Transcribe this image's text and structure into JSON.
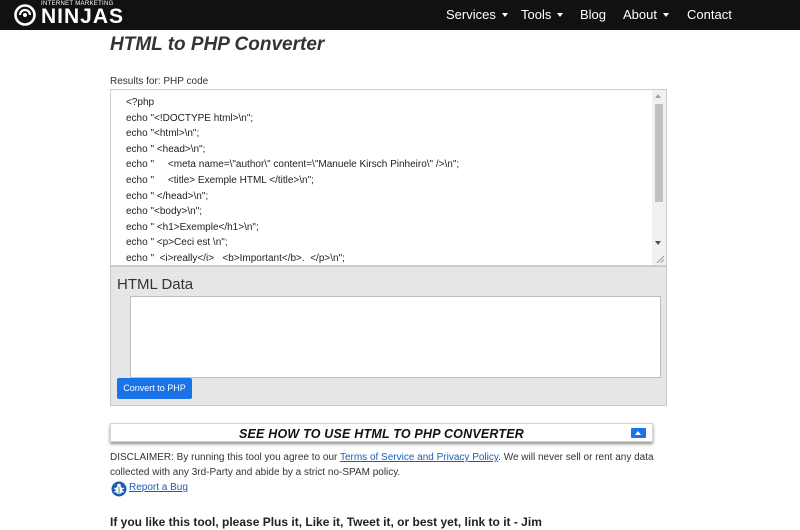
{
  "brand": {
    "small_text": "INTERNET MARKETING",
    "big_text": "NINJAS"
  },
  "nav": {
    "services": "Services",
    "tools": "Tools",
    "blog": "Blog",
    "about": "About",
    "contact": "Contact"
  },
  "page": {
    "title": "HTML to PHP Converter"
  },
  "results": {
    "label": "Results for: PHP code",
    "lines": [
      "<?php",
      "echo \"<!DOCTYPE html>\\n\";",
      "echo \"<html>\\n\";",
      "echo \" <head>\\n\";",
      "echo \"     <meta name=\\\"author\\\" content=\\\"Manuele Kirsch Pinheiro\\\" />\\n\";",
      "echo \"     <title> Exemple HTML </title>\\n\";",
      "echo \" </head>\\n\";",
      "echo \"<body>\\n\";",
      "echo \" <h1>Exemple</h1>\\n\";",
      "echo \" <p>Ceci est \\n\";",
      "echo \"  <i>really</i>   <b>Important</b>.  </p>\\n\";"
    ]
  },
  "html_data": {
    "title": "HTML Data",
    "value": "",
    "convert_label": "Convert to PHP"
  },
  "howto": {
    "label": "SEE HOW TO USE HTML TO PHP CONVERTER"
  },
  "disclaimer": {
    "prefix": "DISCLAIMER: By running this tool you agree to our ",
    "link": "Terms of Service and Privacy Policy",
    "suffix": ". We will never sell or rent any data collected with any 3rd-Party and abide by a strict no-SPAM policy."
  },
  "bug": {
    "label": "Report a Bug"
  },
  "footer": {
    "heading": "If you like this tool, please Plus it, Like it, Tweet it, or best yet, link to it - Jim"
  },
  "colors": {
    "navbar": "#111111",
    "accent_blue": "#1a73e8",
    "link": "#1a5fb4",
    "panel_gray": "#e6e6e6"
  }
}
